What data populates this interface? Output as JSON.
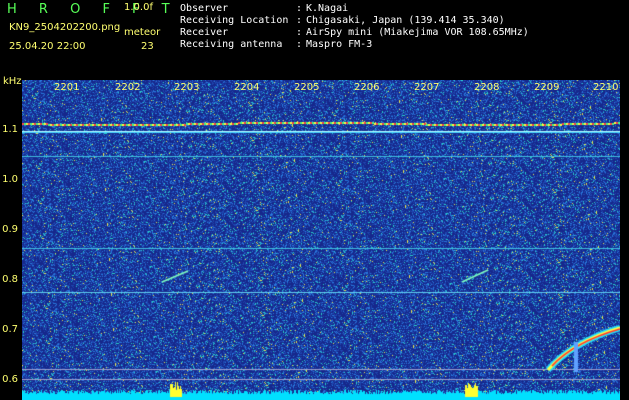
{
  "header": {
    "app_title": "H R O F F T",
    "filter_mode": "1.0.0f",
    "filename": "KN9_2504202200.png",
    "meteor_label": "meteor",
    "datetime": "25.04.20 22:00",
    "meteor_count": "23"
  },
  "metadata": [
    {
      "key": "Observer",
      "value": "K.Nagai"
    },
    {
      "key": "Receiving Location",
      "value": "Chigasaki, Japan (139.414 35.340)"
    },
    {
      "key": "Receiver",
      "value": "AirSpy mini (Miakejima VOR 108.65MHz)"
    },
    {
      "key": "Receiving antenna",
      "value": "Maspro FM-3"
    }
  ],
  "metadata_separator": ":",
  "axes": {
    "y_unit": "kHz",
    "y_ticks": [
      "1.1",
      "1.0",
      "0.9",
      "0.8",
      "0.7",
      "0.6"
    ],
    "x_ticks": [
      "2201",
      "2202",
      "2203",
      "2204",
      "2205",
      "2206",
      "2207",
      "2208",
      "2209",
      "2210"
    ]
  },
  "colors": {
    "background": "#000000",
    "spectrogram_base": "#1e2f88",
    "header_green": "#58ff58",
    "label_yellow": "#ffff70",
    "trace_red": "#ff3030",
    "noise_floor": "#00e0ff"
  }
}
